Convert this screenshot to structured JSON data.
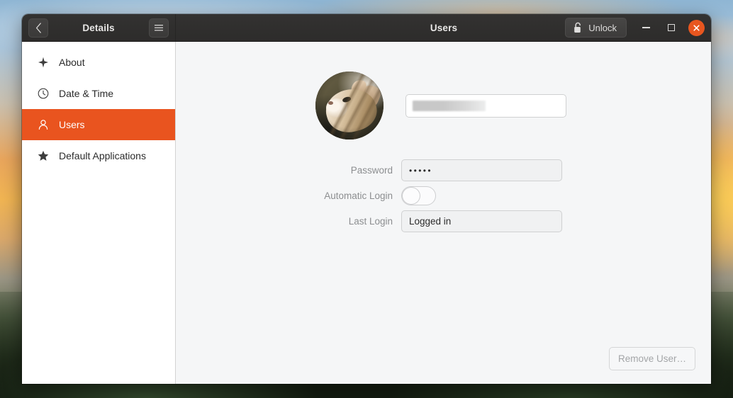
{
  "titlebar": {
    "back_icon": "chevron-left-icon",
    "sidebar_title": "Details",
    "menu_icon": "hamburger-menu-icon",
    "page_title": "Users",
    "unlock_label": "Unlock",
    "unlock_icon": "padlock-open-icon",
    "minimize_icon": "minimize-icon",
    "maximize_icon": "maximize-icon",
    "close_icon": "close-icon",
    "close_color": "#e8561f"
  },
  "sidebar": {
    "items": [
      {
        "label": "About",
        "icon": "sparkle-icon",
        "active": false
      },
      {
        "label": "Date & Time",
        "icon": "clock-icon",
        "active": false
      },
      {
        "label": "Users",
        "icon": "person-icon",
        "active": true
      },
      {
        "label": "Default Applications",
        "icon": "star-icon",
        "active": false
      }
    ],
    "active_color": "#e9541f"
  },
  "main": {
    "avatar_alt": "cat-profile-photo",
    "name_value": "",
    "name_redacted": true,
    "fields": [
      {
        "label": "Password",
        "value": "•••••",
        "type": "password"
      },
      {
        "label": "Automatic Login",
        "value": "off",
        "type": "toggle"
      },
      {
        "label": "Last Login",
        "value": "Logged in",
        "type": "text"
      }
    ],
    "remove_user_label": "Remove User…"
  }
}
